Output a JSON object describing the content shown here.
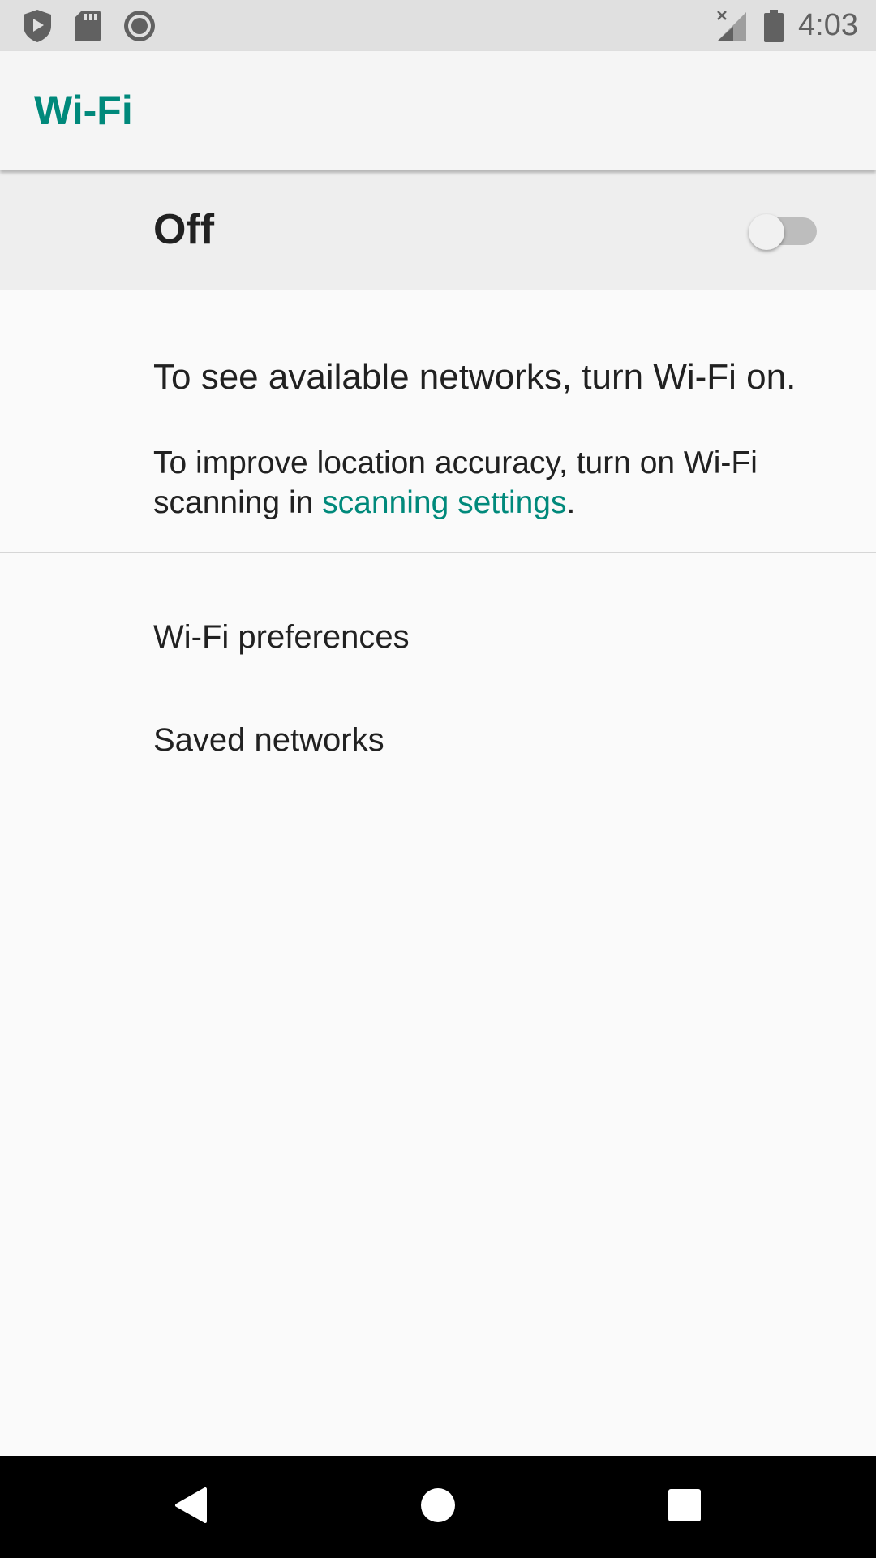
{
  "status_bar": {
    "time": "4:03",
    "left_icons": [
      "shield-play-icon",
      "sd-card-icon",
      "circle-record-icon"
    ],
    "right_icons": [
      "no-signal-icon",
      "battery-icon"
    ]
  },
  "app_bar": {
    "title": "Wi-Fi",
    "accent_color": "#00897b"
  },
  "master_switch": {
    "label": "Off",
    "checked": false
  },
  "info": {
    "title": "To see available networks, turn Wi-Fi on.",
    "body_prefix": "To improve location accuracy, turn on Wi-Fi scanning in ",
    "body_link": "scanning settings",
    "body_suffix": "."
  },
  "preferences": {
    "items": [
      {
        "label": "Wi-Fi preferences"
      },
      {
        "label": "Saved networks"
      }
    ]
  },
  "nav_bar": {
    "icons": [
      "back-icon",
      "home-icon",
      "recents-icon"
    ]
  }
}
